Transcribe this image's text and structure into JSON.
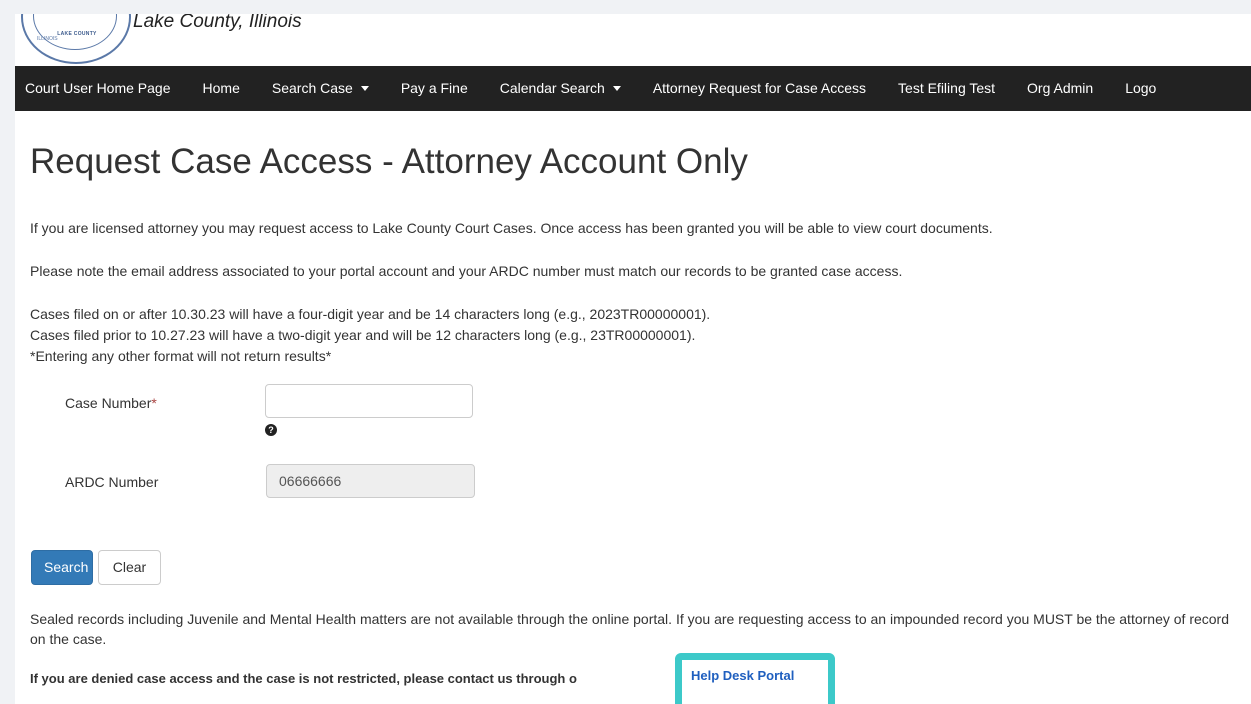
{
  "header": {
    "county_name": "Lake County, Illinois",
    "seal_text": "LAKE COUNTY",
    "seal_rim": "ILLINOIS"
  },
  "nav": {
    "items": [
      {
        "label": "Court User Home Page",
        "dropdown": false
      },
      {
        "label": "Home",
        "dropdown": false
      },
      {
        "label": "Search Case",
        "dropdown": true
      },
      {
        "label": "Pay a Fine",
        "dropdown": false
      },
      {
        "label": "Calendar Search",
        "dropdown": true
      },
      {
        "label": "Attorney Request for Case Access",
        "dropdown": false
      },
      {
        "label": "Test Efiling Test",
        "dropdown": false
      },
      {
        "label": "Org Admin",
        "dropdown": false
      },
      {
        "label": "Logo",
        "dropdown": false
      }
    ]
  },
  "main": {
    "title": "Request Case Access - Attorney Account Only",
    "intro": "If you are licensed attorney you may request access to Lake County Court Cases. Once access has been granted you will be able to view court documents.",
    "note": "Please note the email address associated to your portal account and your ARDC number must match our records to be granted case access.",
    "format_line1": "Cases filed on or after 10.30.23 will have a four-digit year and be 14 characters long (e.g., 2023TR00000001).",
    "format_line2": "Cases filed prior to 10.27.23 will have a two-digit year and will be 12 characters long (e.g., 23TR00000001).",
    "format_line3": "*Entering any other format will not return results*",
    "case_number_label": "Case Number",
    "required_marker": "*",
    "case_number_value": "",
    "help_icon_glyph": "?",
    "ardc_label": "ARDC Number",
    "ardc_value": "06666666",
    "search_button": "Search",
    "clear_button": "Clear",
    "sealed_notice": "Sealed records including Juvenile and Mental Health matters are not available through the online portal. If you are requesting access to an impounded record you MUST be the attorney of record on the case.",
    "denied_text": "If you are denied case access and the case is not restricted, please contact us through o",
    "help_desk_link": "Help Desk Portal"
  },
  "colors": {
    "nav_bg": "#222222",
    "primary_button": "#337ab7",
    "highlight_border": "#3cc9c9",
    "link": "#1f5fbf"
  }
}
